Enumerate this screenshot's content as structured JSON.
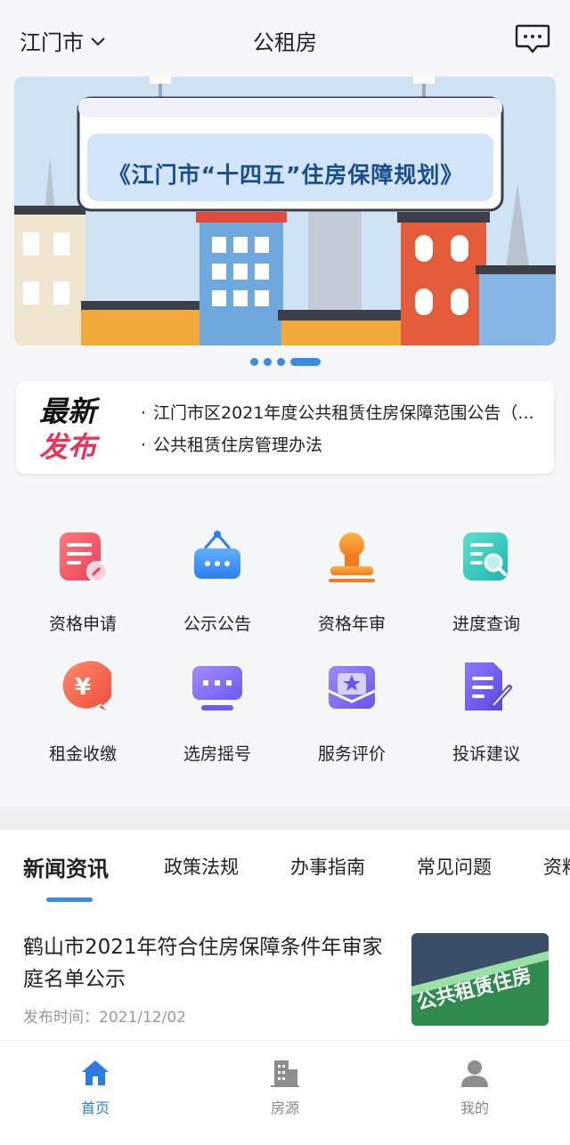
{
  "header": {
    "city": "江门市",
    "title": "公租房",
    "icons": {
      "city_dropdown": "chevron-down-icon",
      "message": "message-icon"
    }
  },
  "banner": {
    "text": "《江门市“十四五”住房保障规划》",
    "slide_count": 4,
    "active_slide": 4
  },
  "notice": {
    "logo_line1": "最新",
    "logo_line2": "发布",
    "items": [
      "江门市区2021年度公共租赁住房保障范围公告（...",
      "公共租赁住房管理办法"
    ]
  },
  "services": [
    {
      "label": "资格申请",
      "icon": "application-form-icon"
    },
    {
      "label": "公示公告",
      "icon": "notice-board-icon"
    },
    {
      "label": "资格年审",
      "icon": "stamp-icon"
    },
    {
      "label": "进度查询",
      "icon": "progress-search-icon"
    },
    {
      "label": "租金收缴",
      "icon": "rent-payment-icon"
    },
    {
      "label": "选房摇号",
      "icon": "lottery-screen-icon"
    },
    {
      "label": "服务评价",
      "icon": "rating-star-icon"
    },
    {
      "label": "投诉建议",
      "icon": "complaint-edit-icon"
    }
  ],
  "news": {
    "tabs": [
      "新闻资讯",
      "政策法规",
      "办事指南",
      "常见问题",
      "资料"
    ],
    "active_tab": 0,
    "article": {
      "title": "鹤山市2021年符合住房保障条件年审家庭名单公示",
      "date_label": "发布时间：",
      "date": "2021/12/02",
      "thumb_text": "公共租赁住房"
    }
  },
  "tabbar": {
    "items": [
      {
        "label": "首页",
        "icon": "home-icon",
        "active": true
      },
      {
        "label": "房源",
        "icon": "building-icon",
        "active": false
      },
      {
        "label": "我的",
        "icon": "user-icon",
        "active": false
      }
    ]
  },
  "colors": {
    "accent": "#3c8de0",
    "notice_red": "#e8345b",
    "banner_text": "#1a4d8f"
  }
}
